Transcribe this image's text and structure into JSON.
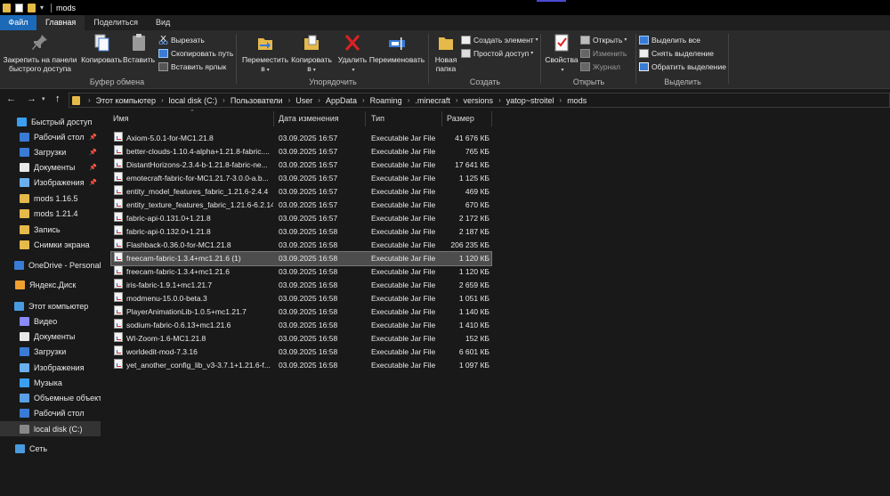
{
  "window": {
    "title": "mods"
  },
  "tabs": [
    "Файл",
    "Главная",
    "Поделиться",
    "Вид"
  ],
  "ribbon": {
    "clipboard": {
      "pin_line1": "Закрепить на панели",
      "pin_line2": "быстрого доступа",
      "copy": "Копировать",
      "paste": "Вставить",
      "cut": "Вырезать",
      "copy_path": "Скопировать путь",
      "paste_shortcut": "Вставить ярлык",
      "label": "Буфер обмена"
    },
    "organize": {
      "move_line1": "Переместить",
      "move_line2": "в",
      "copy_line1": "Копировать",
      "copy_line2": "в",
      "delete": "Удалить",
      "rename": "Переименовать",
      "label": "Упорядочить"
    },
    "create": {
      "new_folder_line1": "Новая",
      "new_folder_line2": "папка",
      "new_item": "Создать элемент",
      "easy_access": "Простой доступ",
      "label": "Создать"
    },
    "open": {
      "properties": "Свойства",
      "open": "Открыть",
      "edit": "Изменить",
      "history": "Журнал",
      "label": "Открыть"
    },
    "select": {
      "select_all": "Выделить все",
      "select_none": "Снять выделение",
      "invert": "Обратить выделение",
      "label": "Выделить"
    }
  },
  "address": {
    "crumbs": [
      "Этот компьютер",
      "local disk (C:)",
      "Пользователи",
      "User",
      "AppData",
      "Roaming",
      ".minecraft",
      "versions",
      "yatop~stroitel",
      "mods"
    ]
  },
  "sidebar": {
    "items": [
      {
        "label": "Быстрый доступ",
        "icon": "star-icon",
        "pinned": false
      },
      {
        "label": "Рабочий стол",
        "icon": "desktop-icon",
        "pinned": true
      },
      {
        "label": "Загрузки",
        "icon": "downloads-icon",
        "pinned": true
      },
      {
        "label": "Документы",
        "icon": "documents-icon",
        "pinned": true
      },
      {
        "label": "Изображения",
        "icon": "pictures-icon",
        "pinned": true
      },
      {
        "label": "mods 1.16.5",
        "icon": "folder-icon",
        "pinned": false
      },
      {
        "label": "mods 1.21.4",
        "icon": "folder-icon",
        "pinned": false
      },
      {
        "label": "Запись",
        "icon": "folder-icon",
        "pinned": false
      },
      {
        "label": "Снимки экрана",
        "icon": "folder-icon",
        "pinned": false
      },
      {
        "label": "OneDrive - Personal",
        "icon": "cloud-icon",
        "pinned": false
      },
      {
        "label": "Яндекс.Диск",
        "icon": "yandex-disk-icon",
        "pinned": false
      },
      {
        "label": "Этот компьютер",
        "icon": "computer-icon",
        "pinned": false
      },
      {
        "label": "Видео",
        "icon": "video-icon",
        "pinned": false
      },
      {
        "label": "Документы",
        "icon": "documents-icon",
        "pinned": false
      },
      {
        "label": "Загрузки",
        "icon": "downloads-icon",
        "pinned": false
      },
      {
        "label": "Изображения",
        "icon": "pictures-icon",
        "pinned": false
      },
      {
        "label": "Музыка",
        "icon": "music-icon",
        "pinned": false
      },
      {
        "label": "Объемные объекты",
        "icon": "3d-objects-icon",
        "pinned": false
      },
      {
        "label": "Рабочий стол",
        "icon": "desktop-icon",
        "pinned": false
      },
      {
        "label": "local disk (C:)",
        "icon": "drive-icon",
        "pinned": false
      },
      {
        "label": "Сеть",
        "icon": "network-icon",
        "pinned": false
      }
    ],
    "pin_glyph": "📌"
  },
  "columns": {
    "name": "Имя",
    "date": "Дата изменения",
    "type": "Тип",
    "size": "Размер"
  },
  "files": [
    {
      "name": "Axiom-5.0.1-for-MC1.21.8",
      "date": "03.09.2025 16:57",
      "type": "Executable Jar File",
      "size": "41 676 КБ"
    },
    {
      "name": "better-clouds-1.10.4-alpha+1.21.8-fabric....",
      "date": "03.09.2025 16:57",
      "type": "Executable Jar File",
      "size": "765 КБ"
    },
    {
      "name": "DistantHorizons-2.3.4-b-1.21.8-fabric-ne...",
      "date": "03.09.2025 16:57",
      "type": "Executable Jar File",
      "size": "17 641 КБ"
    },
    {
      "name": "emotecraft-fabric-for-MC1.21.7-3.0.0-a.b...",
      "date": "03.09.2025 16:57",
      "type": "Executable Jar File",
      "size": "1 125 КБ"
    },
    {
      "name": "entity_model_features_fabric_1.21.6-2.4.4",
      "date": "03.09.2025 16:57",
      "type": "Executable Jar File",
      "size": "469 КБ"
    },
    {
      "name": "entity_texture_features_fabric_1.21.6-6.2.14",
      "date": "03.09.2025 16:57",
      "type": "Executable Jar File",
      "size": "670 КБ"
    },
    {
      "name": "fabric-api-0.131.0+1.21.8",
      "date": "03.09.2025 16:57",
      "type": "Executable Jar File",
      "size": "2 172 КБ"
    },
    {
      "name": "fabric-api-0.132.0+1.21.8",
      "date": "03.09.2025 16:58",
      "type": "Executable Jar File",
      "size": "2 187 КБ"
    },
    {
      "name": "Flashback-0.36.0-for-MC1.21.8",
      "date": "03.09.2025 16:58",
      "type": "Executable Jar File",
      "size": "206 235 КБ"
    },
    {
      "name": "freecam-fabric-1.3.4+mc1.21.6 (1)",
      "date": "03.09.2025 16:58",
      "type": "Executable Jar File",
      "size": "1 120 КБ",
      "selected": true
    },
    {
      "name": "freecam-fabric-1.3.4+mc1.21.6",
      "date": "03.09.2025 16:58",
      "type": "Executable Jar File",
      "size": "1 120 КБ"
    },
    {
      "name": "iris-fabric-1.9.1+mc1.21.7",
      "date": "03.09.2025 16:58",
      "type": "Executable Jar File",
      "size": "2 659 КБ"
    },
    {
      "name": "modmenu-15.0.0-beta.3",
      "date": "03.09.2025 16:58",
      "type": "Executable Jar File",
      "size": "1 051 КБ"
    },
    {
      "name": "PlayerAnimationLib-1.0.5+mc1.21.7",
      "date": "03.09.2025 16:58",
      "type": "Executable Jar File",
      "size": "1 140 КБ"
    },
    {
      "name": "sodium-fabric-0.6.13+mc1.21.6",
      "date": "03.09.2025 16:58",
      "type": "Executable Jar File",
      "size": "1 410 КБ"
    },
    {
      "name": "WI-Zoom-1.6-MC1.21.8",
      "date": "03.09.2025 16:58",
      "type": "Executable Jar File",
      "size": "152 КБ"
    },
    {
      "name": "worldedit-mod-7.3.16",
      "date": "03.09.2025 16:58",
      "type": "Executable Jar File",
      "size": "6 601 КБ"
    },
    {
      "name": "yet_another_config_lib_v3-3.7.1+1.21.6-f...",
      "date": "03.09.2025 16:58",
      "type": "Executable Jar File",
      "size": "1 097 КБ"
    }
  ]
}
